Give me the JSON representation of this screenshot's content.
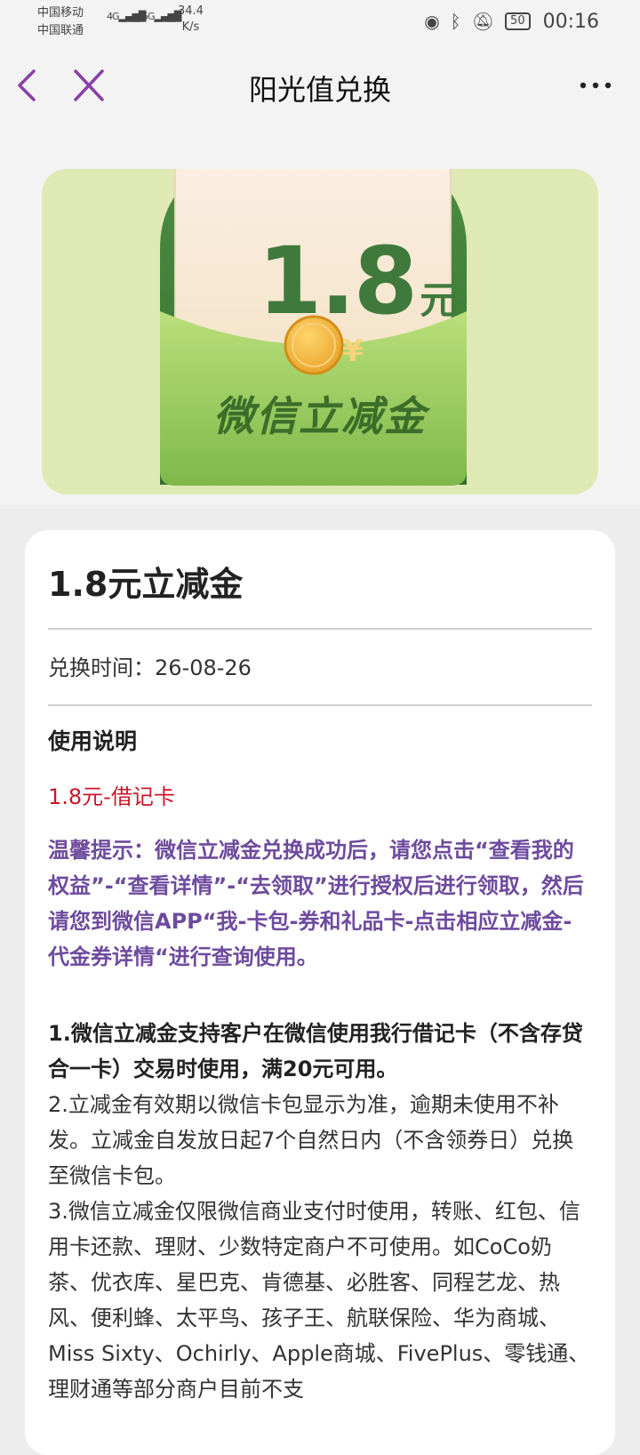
{
  "status_bar": {
    "carrier1": "中国移动",
    "carrier2": "中国联通",
    "net1": "4G",
    "net2": "5G",
    "speed_value": "34.4",
    "speed_unit": "K/s",
    "battery": "50",
    "time": "00:16"
  },
  "nav": {
    "title": "阳光值兑换"
  },
  "banner": {
    "amount": "1.8",
    "unit": "元",
    "coin_symbol": "¥",
    "label": "微信立减金"
  },
  "card": {
    "title": "1.8元立减金",
    "exchange_time": "兑换时间：26-08-26",
    "usage_title": "使用说明",
    "red_note": "1.8元-借记卡",
    "tip": "温馨提示：微信立减金兑换成功后，请您点击“查看我的权益”-“查看详情”-“去领取”进行授权后进行领取，然后请您到微信APP“我-卡包-券和礼品卡-点击相应立减金-代金券详情“进行查询使用。",
    "rule1": "1.微信立减金支持客户在微信使用我行借记卡（不含存贷合一卡）交易时使用，满20元可用。",
    "rule2": "2.立减金有效期以微信卡包显示为准，逾期未使用不补发。立减金自发放日起7个自然日内（不含领券日）兑换至微信卡包。",
    "rule3": "3.微信立减金仅限微信商业支付时使用，转账、红包、信用卡还款、理财、少数特定商户不可使用。如CoCo奶茶、优衣库、星巴克、肯德基、必胜客、同程艺龙、热风、便利蜂、太平鸟、孩子王、航联保险、华为商城、Miss Sixty、Ochirly、Apple商城、FivePlus、零钱通、理财通等部分商户目前不支"
  }
}
